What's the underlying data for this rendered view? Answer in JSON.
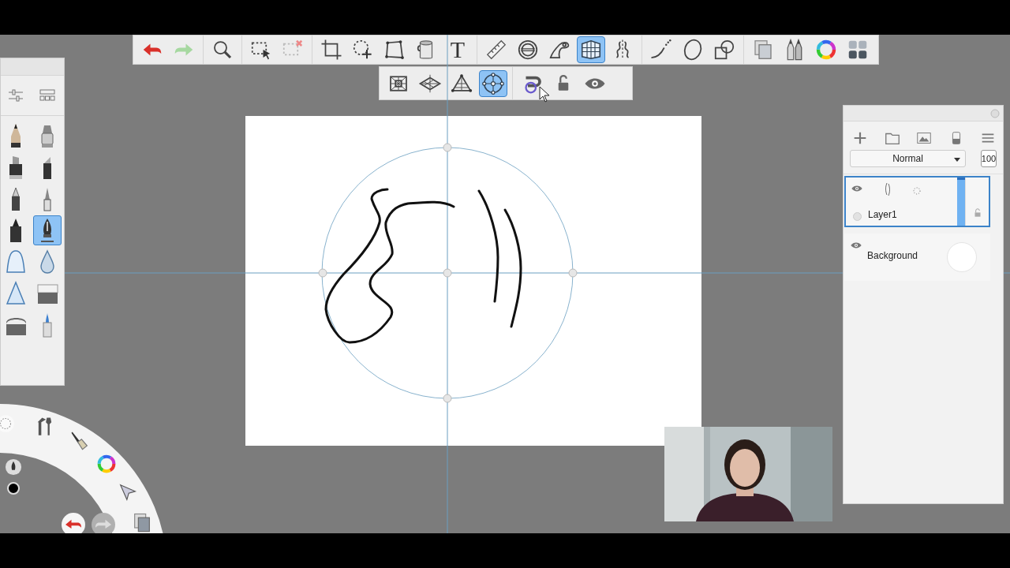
{
  "toolbar": {
    "groups": [
      [
        {
          "kind": "undo",
          "selected": false
        },
        {
          "kind": "redo",
          "selected": false
        }
      ],
      [
        {
          "kind": "zoom",
          "selected": false
        }
      ],
      [
        {
          "kind": "select",
          "selected": false
        },
        {
          "kind": "deselect",
          "selected": false
        }
      ],
      [
        {
          "kind": "crop",
          "selected": false
        },
        {
          "kind": "transform",
          "selected": false
        },
        {
          "kind": "distort",
          "selected": false
        },
        {
          "kind": "fill",
          "selected": false
        },
        {
          "kind": "text",
          "label": "T",
          "selected": false
        }
      ],
      [
        {
          "kind": "ruler",
          "selected": false
        },
        {
          "kind": "ellipse",
          "selected": false
        },
        {
          "kind": "curve",
          "selected": false
        },
        {
          "kind": "perspective",
          "selected": true
        },
        {
          "kind": "symmetry",
          "selected": false
        }
      ],
      [
        {
          "kind": "stroke",
          "selected": false
        },
        {
          "kind": "circle",
          "selected": false
        },
        {
          "kind": "shapes",
          "selected": false
        }
      ],
      [
        {
          "kind": "copy",
          "selected": false
        },
        {
          "kind": "brushes",
          "selected": false
        },
        {
          "kind": "colorwheel",
          "selected": false
        },
        {
          "kind": "swatches",
          "selected": false
        }
      ]
    ]
  },
  "perspective_bar": {
    "groups": [
      [
        {
          "kind": "onepoint",
          "selected": false
        },
        {
          "kind": "twopoint",
          "selected": false
        },
        {
          "kind": "threepoint",
          "selected": false
        },
        {
          "kind": "fisheye",
          "selected": true
        }
      ],
      [
        {
          "kind": "snap",
          "selected": false
        },
        {
          "kind": "lock",
          "selected": false
        },
        {
          "kind": "eye",
          "selected": false
        }
      ]
    ]
  },
  "brush_panel": {
    "tools": [
      {
        "kind": "sliders"
      },
      {
        "kind": "library"
      }
    ],
    "brushes": [
      {
        "kind": "pencil",
        "selected": false
      },
      {
        "kind": "airbrush",
        "selected": false
      },
      {
        "kind": "marker",
        "selected": false
      },
      {
        "kind": "chisel",
        "selected": false
      },
      {
        "kind": "ballpoint",
        "selected": false
      },
      {
        "kind": "finetip",
        "selected": false
      },
      {
        "kind": "felt",
        "selected": false
      },
      {
        "kind": "nib",
        "selected": true
      },
      {
        "kind": "softcone",
        "selected": false
      },
      {
        "kind": "drop",
        "selected": false
      },
      {
        "kind": "hardcone",
        "selected": false
      },
      {
        "kind": "eraser",
        "selected": false
      },
      {
        "kind": "rounderaser",
        "selected": false
      },
      {
        "kind": "brushpen",
        "selected": false
      }
    ]
  },
  "layers_panel": {
    "blend_mode": "Normal",
    "opacity": "100",
    "layers": [
      {
        "name": "Layer1",
        "kind": "sketch",
        "selected": true,
        "visible": true,
        "level": 1
      },
      {
        "name": "Background",
        "kind": "background",
        "selected": false,
        "visible": true
      }
    ]
  }
}
